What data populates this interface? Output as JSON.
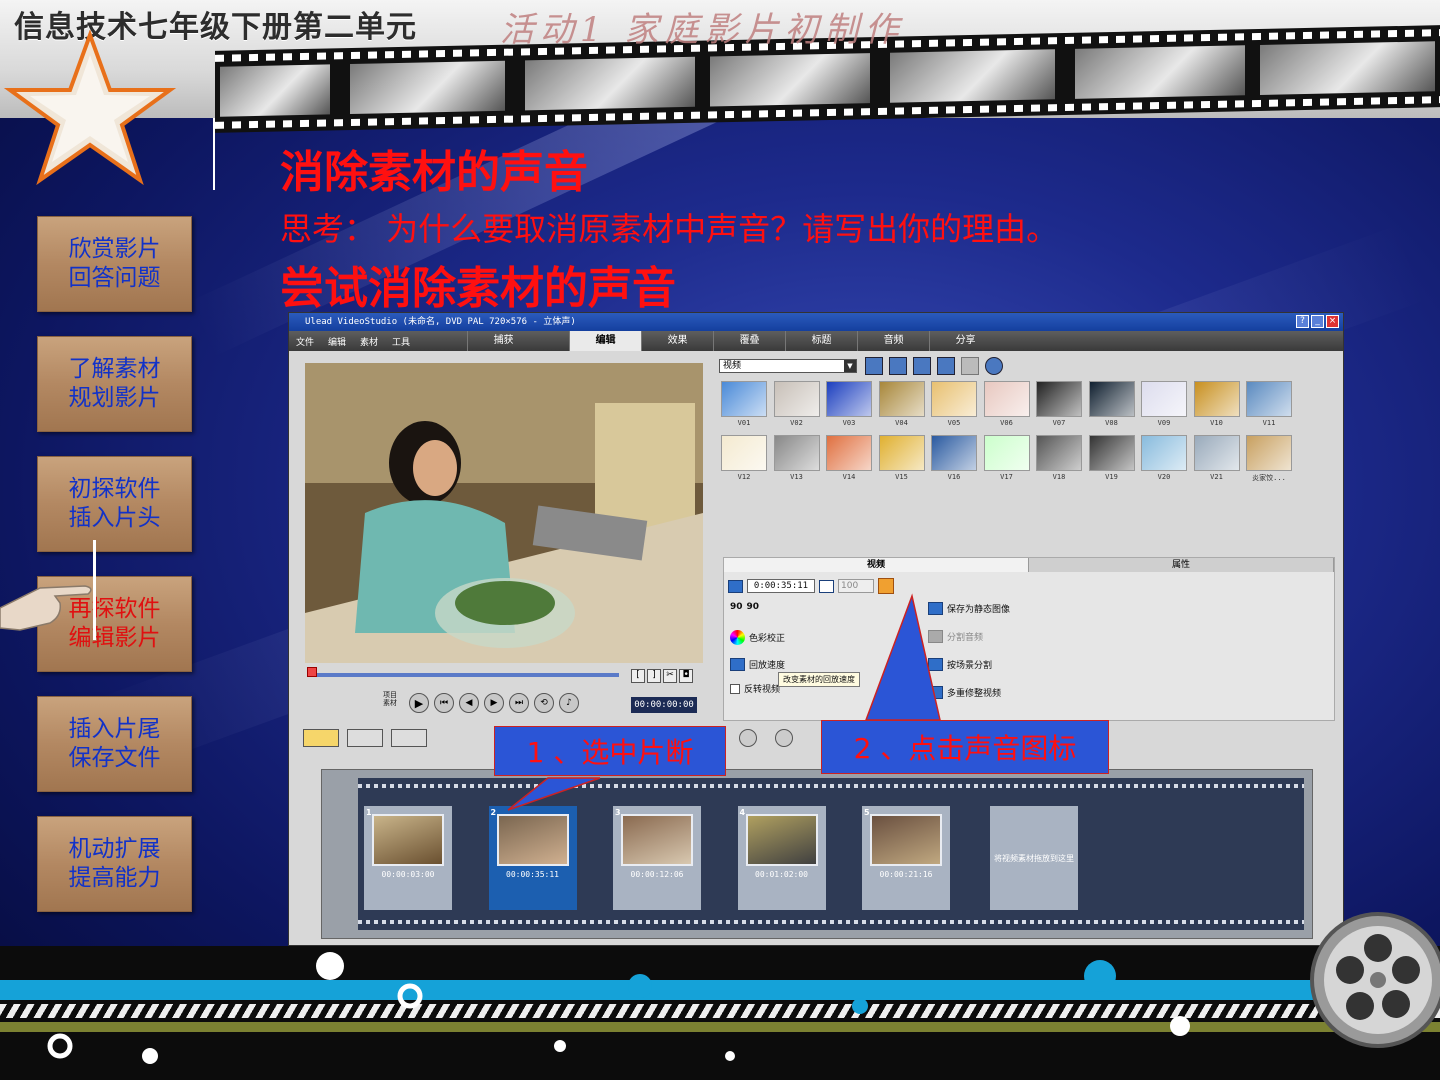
{
  "header": {
    "course_title": "信息技术七年级下册第二单元",
    "activity_title": "活动1 家庭影片初制作"
  },
  "nav": {
    "items": [
      {
        "line1": "欣赏影片",
        "line2": "回答问题"
      },
      {
        "line1": "了解素材",
        "line2": "规划影片"
      },
      {
        "line1": "初探软件",
        "line2": "插入片头"
      },
      {
        "line1": "再探软件",
        "line2": "编辑影片"
      },
      {
        "line1": "插入片尾",
        "line2": "保存文件"
      },
      {
        "line1": "机动扩展",
        "line2": "提高能力"
      }
    ],
    "active_index": 3
  },
  "content": {
    "heading": "消除素材的声音",
    "question": "思考： 为什么要取消原素材中声音？请写出你的理由。",
    "subheading": "尝试消除素材的声音"
  },
  "software": {
    "title": "Ulead VideoStudio (未命名, DVD PAL 720×576 - 立体声)",
    "menu": [
      "文件",
      "编辑",
      "素材",
      "工具"
    ],
    "tabs": [
      "捕获",
      "编辑",
      "效果",
      "覆叠",
      "标题",
      "音频",
      "分享"
    ],
    "active_tab": "编辑",
    "library_dropdown": "视频",
    "library_thumbs": [
      "V01",
      "V02",
      "V03",
      "V04",
      "V05",
      "V06",
      "V07",
      "V08",
      "V09",
      "V10",
      "V11",
      "V12",
      "V13",
      "V14",
      "V15",
      "V16",
      "V17",
      "V18",
      "V19",
      "V20",
      "V21",
      "炎家饺..."
    ],
    "panel_tabs": [
      "视频",
      "属性"
    ],
    "timecode": "0:00:35:11",
    "volume": "100",
    "preview_timecode": "00:00:00:00",
    "preview_labels": {
      "project": "项目",
      "clip": "素材"
    },
    "rotate_labels": [
      "90",
      "90"
    ],
    "options": {
      "color_correct": "色彩校正",
      "playback_speed": "回放速度",
      "reverse": "反转视频",
      "tooltip": "改变素材的回放速度",
      "save_still": "保存为静态图像",
      "split_audio": "分割音频",
      "split_by_scene": "按场景分割",
      "multi_trim": "多重修整视频"
    },
    "clips": [
      {
        "num": "1",
        "tc": "00:00:03:00"
      },
      {
        "num": "2",
        "tc": "00:00:35:11"
      },
      {
        "num": "3",
        "tc": "00:00:12:06"
      },
      {
        "num": "4",
        "tc": "00:01:02:00"
      },
      {
        "num": "5",
        "tc": "00:00:21:16"
      }
    ],
    "selected_clip": 1,
    "dropzone_text": "将视频素材拖放到这里"
  },
  "callouts": {
    "step1": "1 、选中片断",
    "step2": "2 、点击声音图标"
  },
  "colors": {
    "heading_red": "#ff1010",
    "nav_text_blue": "#1232c8",
    "callout_fill": "#2b55d6"
  }
}
